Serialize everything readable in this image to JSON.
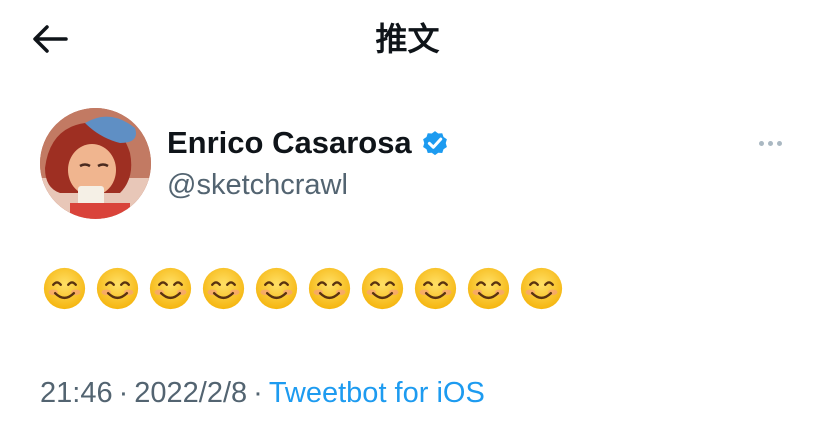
{
  "header": {
    "title": "推文",
    "back_icon": "arrow-left-icon"
  },
  "tweet": {
    "author": {
      "display_name": "Enrico Casarosa",
      "handle": "@sketchcrawl",
      "verified": true
    },
    "body_emojis": [
      "😊",
      "😊",
      "😊",
      "😊",
      "😊",
      "😊",
      "😊",
      "😊",
      "😊",
      "😊"
    ],
    "time": "21:46",
    "separator": "·",
    "date": "2022/2/8",
    "source": "Tweetbot for iOS"
  },
  "colors": {
    "accent": "#1d9bf0",
    "secondary_text": "#536471",
    "primary_text": "#0f1419"
  }
}
